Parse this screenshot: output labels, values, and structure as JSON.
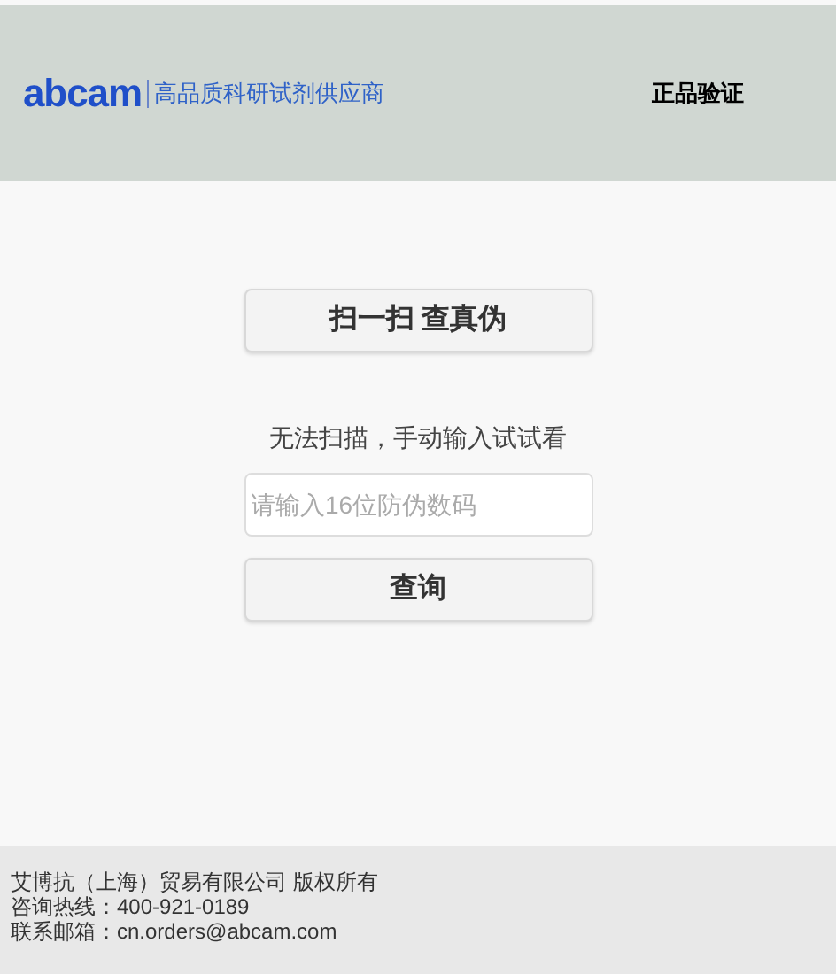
{
  "header": {
    "logo": "abcam",
    "tagline": "高品质科研试剂供应商",
    "title": "正品验证"
  },
  "scan_button": "扫一扫 查真伪",
  "hint": "无法扫描，手动输入试试看",
  "code_field": {
    "placeholder": "请输入16位防伪数码"
  },
  "query_button": "查询",
  "footer": [
    "艾博抗（上海）贸易有限公司 版权所有",
    "咨询热线：400-921-0189",
    "联系邮箱：cn.orders@abcam.com"
  ]
}
